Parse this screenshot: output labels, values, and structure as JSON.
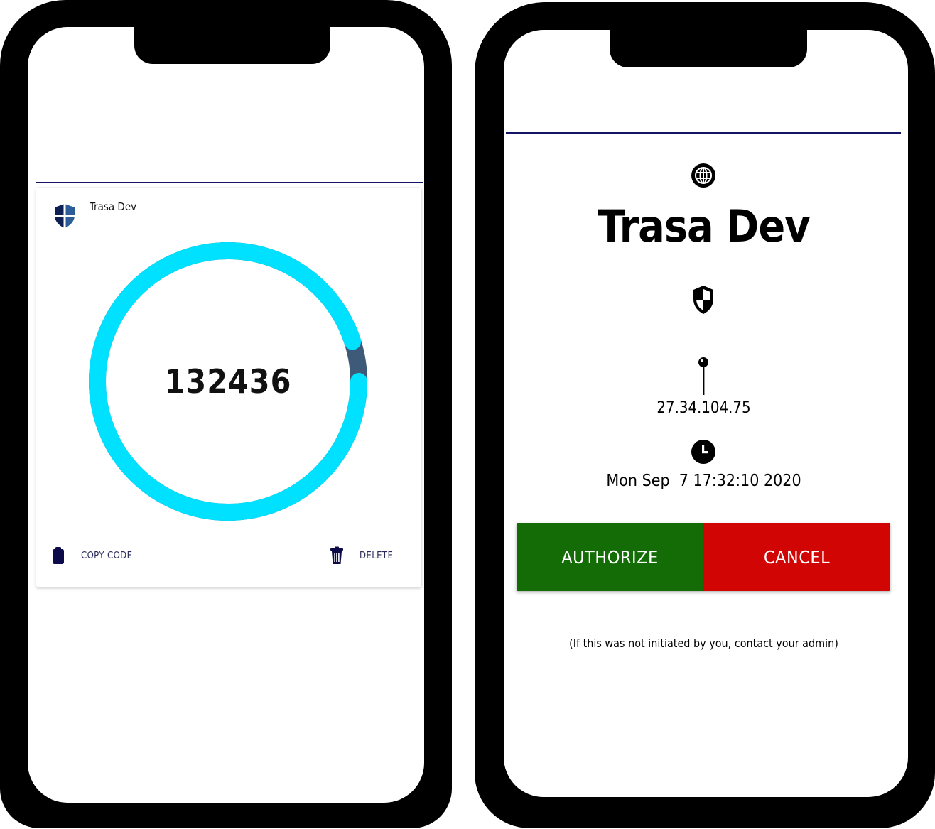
{
  "otp_screen": {
    "account_name": "Trasa Dev",
    "code": "132436",
    "timer": {
      "remaining_fraction": 0.95,
      "colors": {
        "remaining": "#00e1ff",
        "elapsed": "#3d5a78"
      }
    },
    "actions": {
      "copy_label": "COPY CODE",
      "delete_label": "DELETE"
    },
    "icons": {
      "account": "shield-icon",
      "copy": "clipboard-icon",
      "delete": "trash-icon"
    }
  },
  "auth_screen": {
    "title": "Trasa Dev",
    "ip_address": "27.34.104.75",
    "timestamp": "Mon Sep  7 17:32:10 2020",
    "authorize_label": "AUTHORIZE",
    "cancel_label": "CANCEL",
    "note": "(If this was not initiated by you, contact your admin)",
    "icons": {
      "service": "globe-icon",
      "security": "shield-icon",
      "location": "pin-icon",
      "time": "clock-icon"
    }
  },
  "colors": {
    "accent": "#141466",
    "authorize": "#146c07",
    "cancel": "#d20505",
    "icon_dark": "#0d0a4a"
  }
}
